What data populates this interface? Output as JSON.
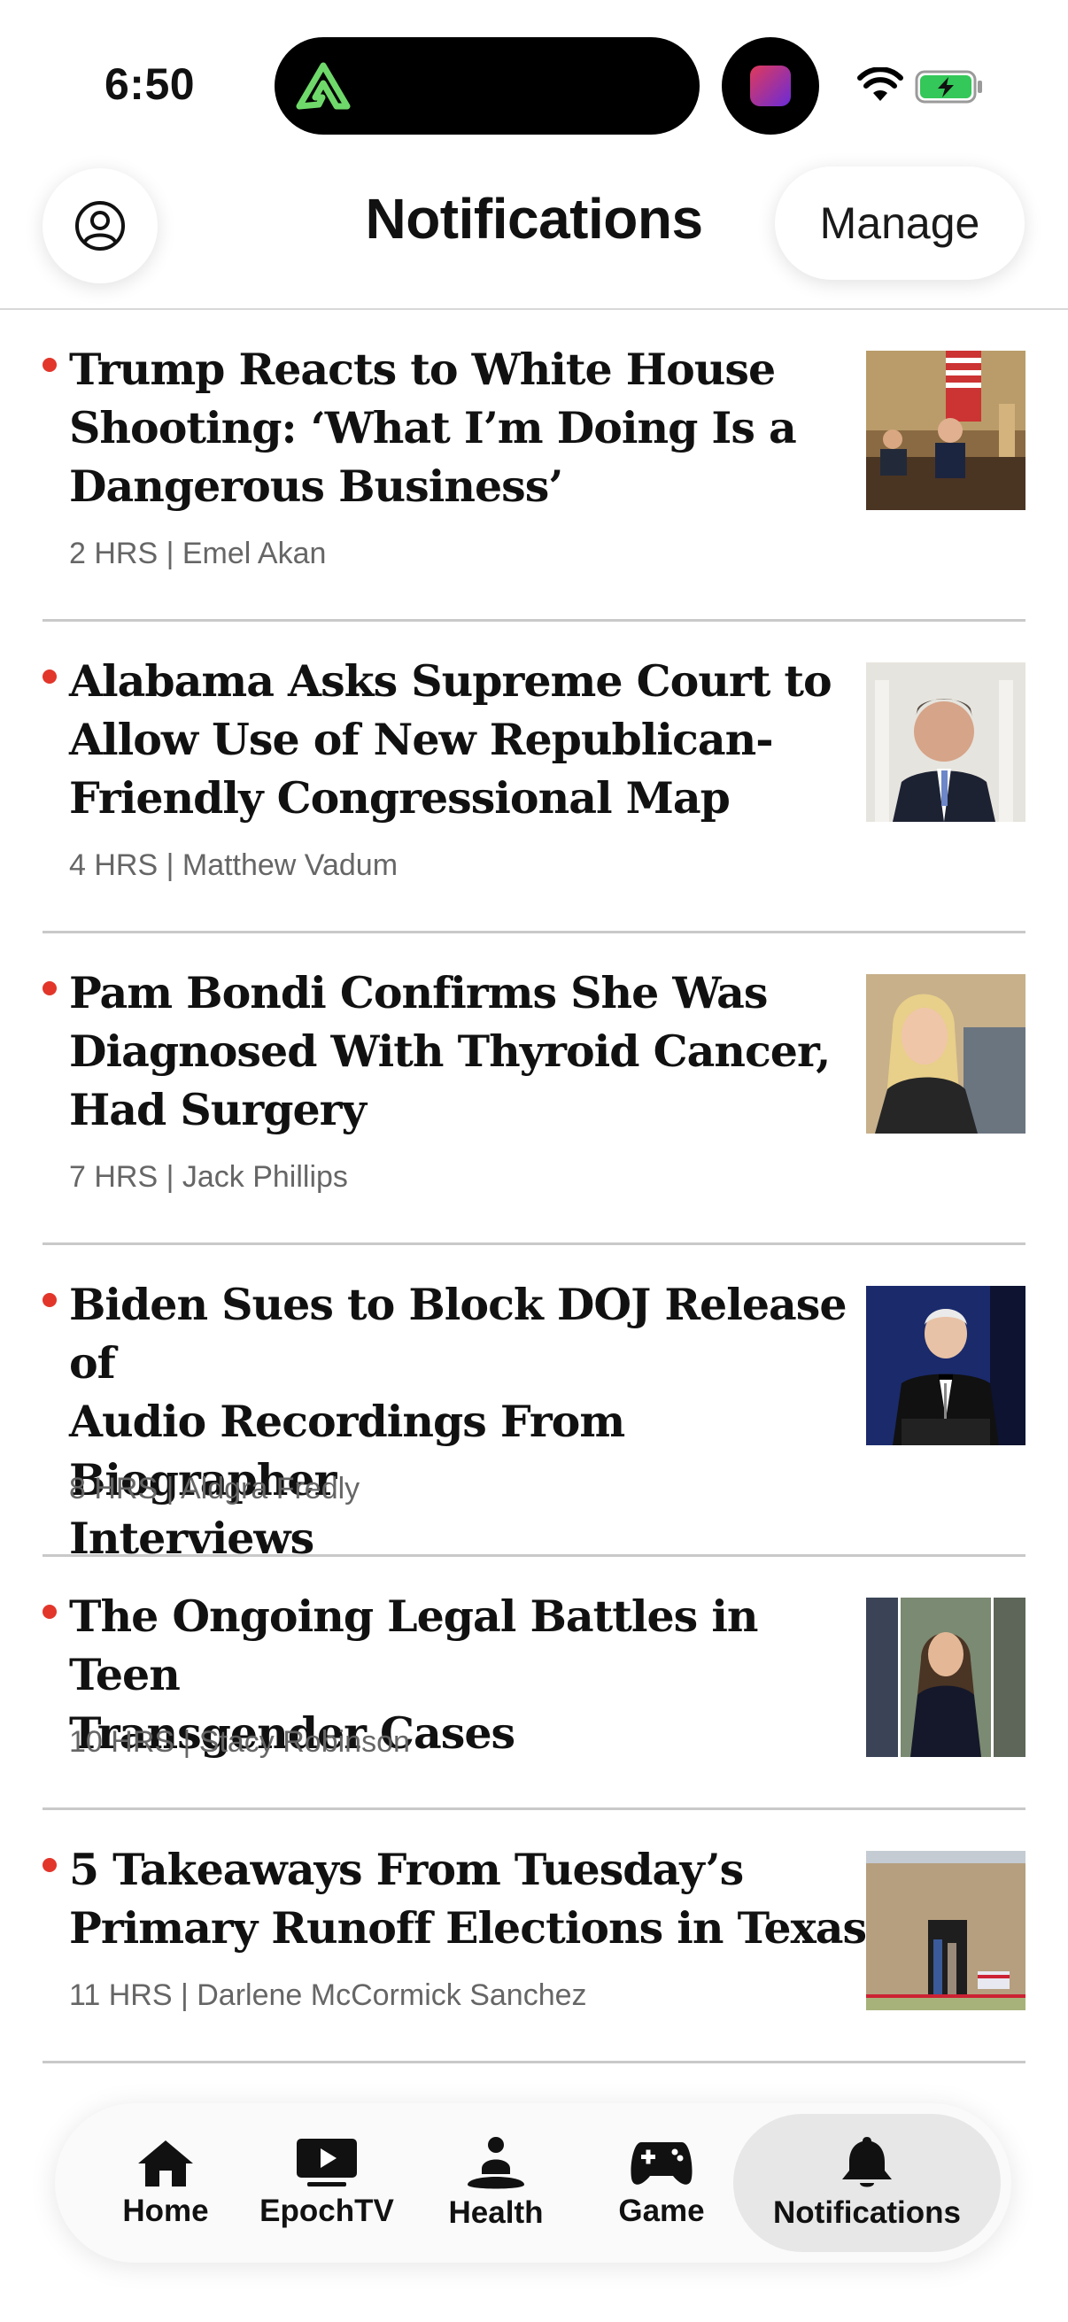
{
  "status_bar": {
    "time": "6:50",
    "colors": {
      "battery": "#34c759",
      "island_app": "#6fd86a"
    }
  },
  "header": {
    "title": "Notifications",
    "manage_label": "Manage",
    "profile_icon": "person-circle-icon"
  },
  "notifications": [
    {
      "lines": [
        "Trump Reacts to White House",
        "Shooting: ‘What I’m Doing Is a",
        "Dangerous Business’"
      ],
      "meta": "2 HRS | Emel Akan"
    },
    {
      "lines": [
        "Alabama Asks Supreme Court to",
        "Allow Use of New Republican-",
        "Friendly Congressional Map"
      ],
      "meta": "4 HRS | Matthew Vadum"
    },
    {
      "lines": [
        "Pam Bondi Confirms She Was",
        "Diagnosed With Thyroid Cancer,",
        "Had Surgery"
      ],
      "meta": "7 HRS | Jack Phillips"
    },
    {
      "lines": [
        "Biden Sues to Block DOJ Release of",
        "Audio Recordings From Biographer",
        "Interviews"
      ],
      "meta": "8 HRS | Aldgra Fredly"
    },
    {
      "lines": [
        "The Ongoing Legal Battles in Teen",
        "Transgender Cases"
      ],
      "meta": "10 HRS | Stacy Robinson"
    },
    {
      "lines": [
        "5 Takeaways From Tuesday’s",
        "Primary Runoff Elections in Texas"
      ],
      "meta": "11 HRS | Darlene McCormick Sanchez"
    }
  ],
  "tabbar": {
    "tabs": [
      {
        "label": "Home",
        "icon": "house-icon"
      },
      {
        "label": "EpochTV",
        "icon": "play-screen-icon"
      },
      {
        "label": "Health",
        "icon": "meditation-icon"
      },
      {
        "label": "Game",
        "icon": "gamepad-icon"
      },
      {
        "label": "Notifications",
        "icon": "bell-icon"
      }
    ],
    "active": "Notifications"
  }
}
